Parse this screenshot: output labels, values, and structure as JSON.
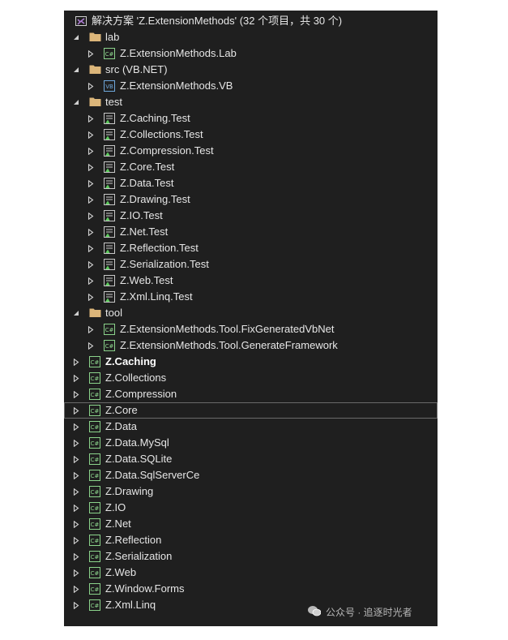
{
  "solution": {
    "label": "解决方案 'Z.ExtensionMethods' (32 个项目，共 30 个)",
    "icon": "solution-icon"
  },
  "tree": [
    {
      "label": "lab",
      "type": "folder",
      "expanded": true,
      "level": 0
    },
    {
      "label": "Z.ExtensionMethods.Lab",
      "type": "csharp",
      "expanded": false,
      "level": 1
    },
    {
      "label": "src (VB.NET)",
      "type": "folder",
      "expanded": true,
      "level": 0
    },
    {
      "label": "Z.ExtensionMethods.VB",
      "type": "vb",
      "expanded": false,
      "level": 1
    },
    {
      "label": "test",
      "type": "folder",
      "expanded": true,
      "level": 0
    },
    {
      "label": "Z.Caching.Test",
      "type": "test",
      "expanded": false,
      "level": 1
    },
    {
      "label": "Z.Collections.Test",
      "type": "test",
      "expanded": false,
      "level": 1
    },
    {
      "label": "Z.Compression.Test",
      "type": "test",
      "expanded": false,
      "level": 1
    },
    {
      "label": "Z.Core.Test",
      "type": "test",
      "expanded": false,
      "level": 1
    },
    {
      "label": "Z.Data.Test",
      "type": "test",
      "expanded": false,
      "level": 1
    },
    {
      "label": "Z.Drawing.Test",
      "type": "test",
      "expanded": false,
      "level": 1
    },
    {
      "label": "Z.IO.Test",
      "type": "test",
      "expanded": false,
      "level": 1
    },
    {
      "label": "Z.Net.Test",
      "type": "test",
      "expanded": false,
      "level": 1
    },
    {
      "label": "Z.Reflection.Test",
      "type": "test",
      "expanded": false,
      "level": 1
    },
    {
      "label": "Z.Serialization.Test",
      "type": "test",
      "expanded": false,
      "level": 1
    },
    {
      "label": "Z.Web.Test",
      "type": "test",
      "expanded": false,
      "level": 1
    },
    {
      "label": "Z.Xml.Linq.Test",
      "type": "test",
      "expanded": false,
      "level": 1
    },
    {
      "label": "tool",
      "type": "folder",
      "expanded": true,
      "level": 0
    },
    {
      "label": "Z.ExtensionMethods.Tool.FixGeneratedVbNet",
      "type": "csharp",
      "expanded": false,
      "level": 1
    },
    {
      "label": "Z.ExtensionMethods.Tool.GenerateFramework",
      "type": "csharp",
      "expanded": false,
      "level": 1
    },
    {
      "label": "Z.Caching",
      "type": "csharp",
      "expanded": false,
      "level": 0,
      "bold": true
    },
    {
      "label": "Z.Collections",
      "type": "csharp",
      "expanded": false,
      "level": 0
    },
    {
      "label": "Z.Compression",
      "type": "csharp",
      "expanded": false,
      "level": 0
    },
    {
      "label": "Z.Core",
      "type": "csharp",
      "expanded": false,
      "level": 0,
      "selected": true
    },
    {
      "label": "Z.Data",
      "type": "csharp",
      "expanded": false,
      "level": 0
    },
    {
      "label": "Z.Data.MySql",
      "type": "csharp",
      "expanded": false,
      "level": 0
    },
    {
      "label": "Z.Data.SQLite",
      "type": "csharp",
      "expanded": false,
      "level": 0
    },
    {
      "label": "Z.Data.SqlServerCe",
      "type": "csharp",
      "expanded": false,
      "level": 0
    },
    {
      "label": "Z.Drawing",
      "type": "csharp",
      "expanded": false,
      "level": 0
    },
    {
      "label": "Z.IO",
      "type": "csharp",
      "expanded": false,
      "level": 0
    },
    {
      "label": "Z.Net",
      "type": "csharp",
      "expanded": false,
      "level": 0
    },
    {
      "label": "Z.Reflection",
      "type": "csharp",
      "expanded": false,
      "level": 0
    },
    {
      "label": "Z.Serialization",
      "type": "csharp",
      "expanded": false,
      "level": 0
    },
    {
      "label": "Z.Web",
      "type": "csharp",
      "expanded": false,
      "level": 0
    },
    {
      "label": "Z.Window.Forms",
      "type": "csharp",
      "expanded": false,
      "level": 0
    },
    {
      "label": "Z.Xml.Linq",
      "type": "csharp",
      "expanded": false,
      "level": 0
    }
  ],
  "icon_text": {
    "csharp": "C#",
    "vb": "VB"
  },
  "watermark": {
    "text": "公众号 · 追逐时光者",
    "icon": "wechat-icon"
  },
  "colors": {
    "background": "#1f1f1f",
    "text": "#e6e6e6",
    "folder": "#dcb67a",
    "csharp_icon": "#8bd38b",
    "vb_icon": "#6fa8dc",
    "selection_border": "#6a6a6a"
  }
}
